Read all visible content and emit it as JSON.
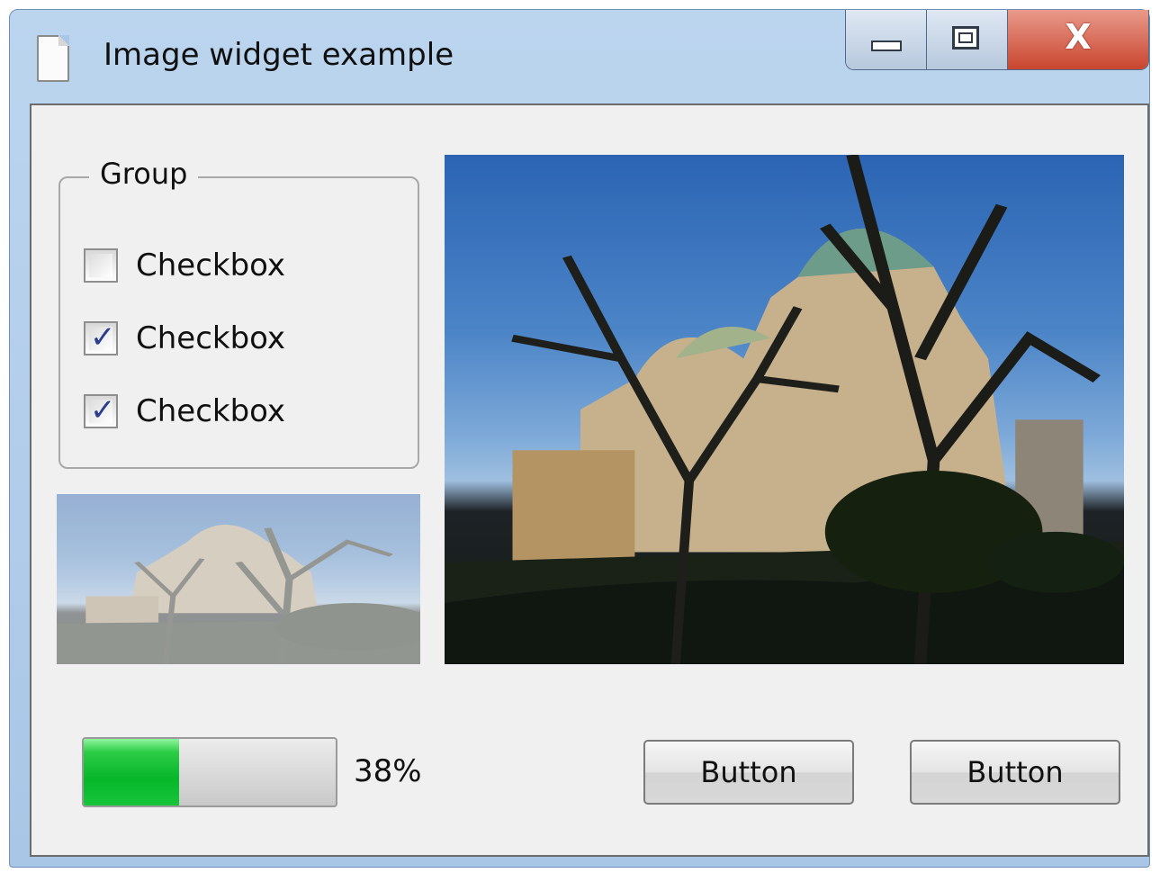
{
  "window": {
    "title": "Image widget example",
    "icon": "document-icon",
    "controls": {
      "minimize_icon": "minimize-icon",
      "maximize_icon": "maximize-icon",
      "close_glyph": "X"
    }
  },
  "group": {
    "title": "Group",
    "checkboxes": [
      {
        "label": "Checkbox",
        "checked": false
      },
      {
        "label": "Checkbox",
        "checked": true
      },
      {
        "label": "Checkbox",
        "checked": true
      }
    ]
  },
  "images": {
    "small": {
      "description_icon": "cathedral-photo-faded",
      "opacity": 0.45
    },
    "large": {
      "description_icon": "cathedral-photo"
    }
  },
  "progress": {
    "value": 38,
    "label": "38%",
    "fill_color": "#06b72a"
  },
  "buttons": [
    {
      "label": "Button"
    },
    {
      "label": "Button"
    }
  ],
  "colors": {
    "title_bar": "#bcd5ef",
    "close_button": "#c9452f",
    "client_background": "#f0f0f0",
    "checkmark": "#2a3d8f"
  }
}
